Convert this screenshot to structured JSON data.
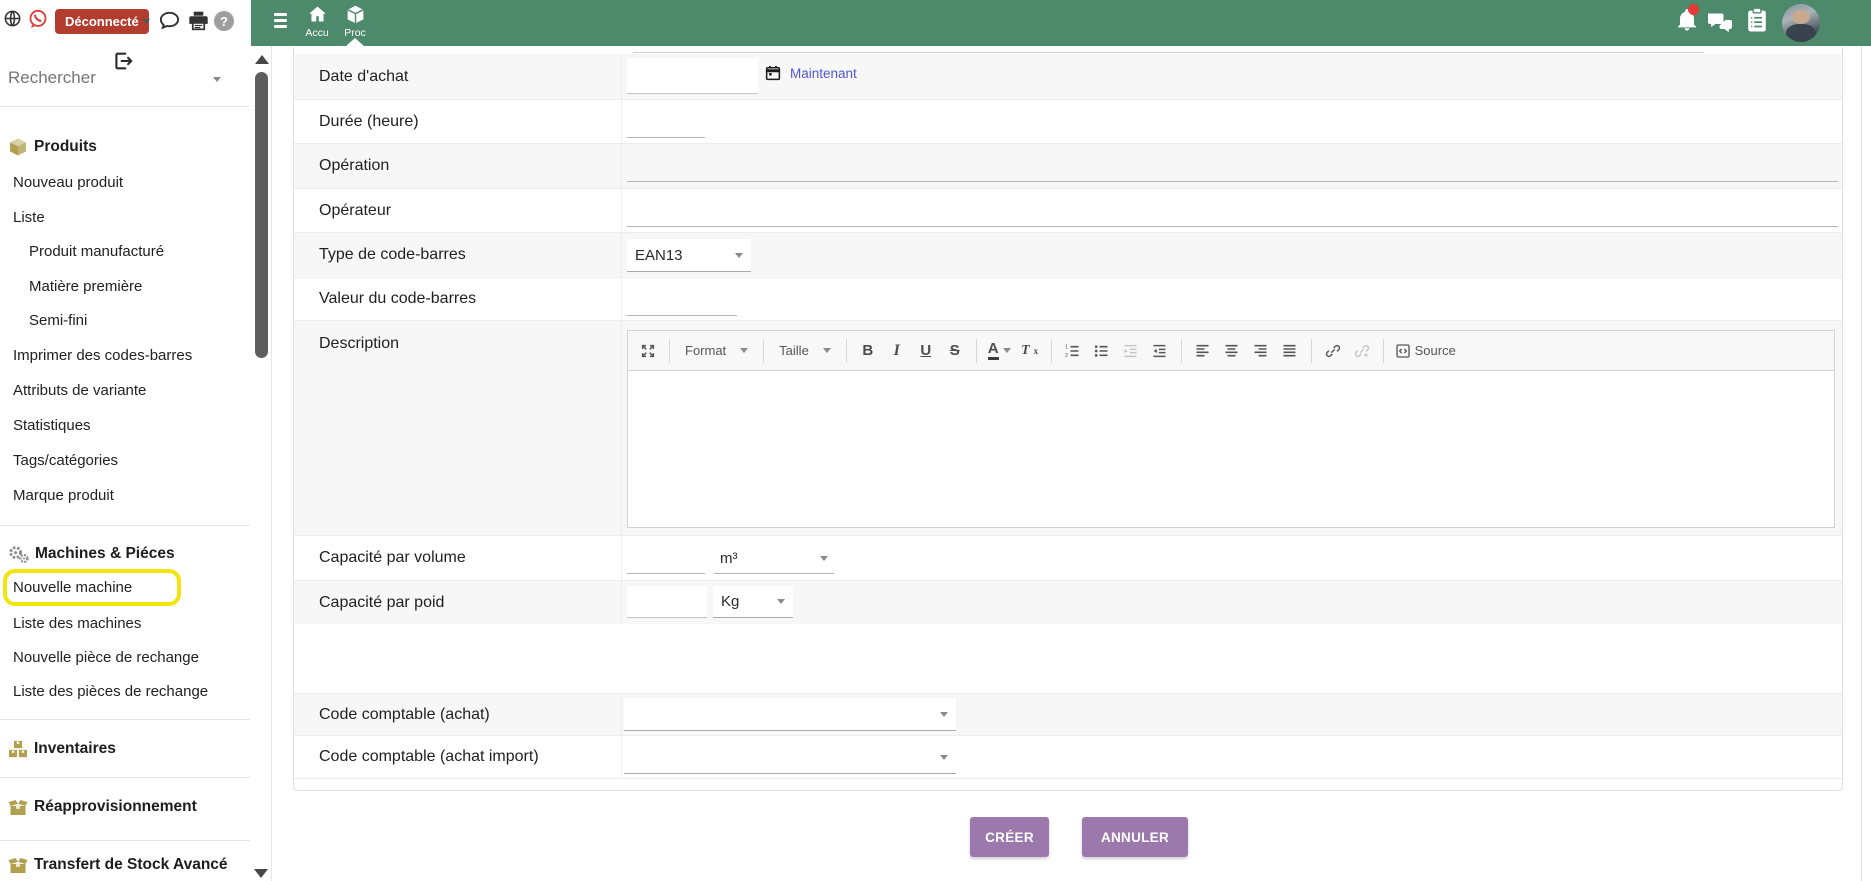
{
  "colors": {
    "topbar_green": "#4d8a6c",
    "button_purple": "#9c79ad",
    "badge_red": "#b23d2e",
    "highlight_yellow": "#f2e40c",
    "link_purple": "#5356d6",
    "gold_icon": "#b0a04f"
  },
  "header": {
    "status_badge": "Déconnecté",
    "nav_items": [
      {
        "label": "Accu"
      },
      {
        "label": "Proc"
      }
    ]
  },
  "sidebar": {
    "search_placeholder": "Rechercher",
    "produits_title": "Produits",
    "items_produits": [
      "Nouveau produit",
      "Liste",
      "Produit manufacturé",
      "Matière première",
      "Semi-fini",
      "Imprimer des codes-barres",
      "Attributs de variante",
      "Statistiques",
      "Tags/catégories",
      "Marque produit"
    ],
    "machines_title": "Machines & Piéces",
    "items_machines": [
      "Nouvelle machine",
      "Liste des machines",
      "Nouvelle pièce de rechange",
      "Liste des pièces de rechange"
    ],
    "inventaires_title": "Inventaires",
    "reappro_title": "Réapprovisionnement",
    "transfert_title": "Transfert de Stock Avancé"
  },
  "form": {
    "rows": [
      {
        "label": "Date d'achat",
        "now_link": "Maintenant",
        "value": ""
      },
      {
        "label": "Durée (heure)",
        "value": ""
      },
      {
        "label": "Opération",
        "value": ""
      },
      {
        "label": "Opérateur",
        "value": ""
      },
      {
        "label": "Type de code-barres",
        "value": "EAN13"
      },
      {
        "label": "Valeur du code-barres",
        "value": ""
      },
      {
        "label": "Description",
        "value": ""
      },
      {
        "label": "Capacité par volume",
        "value": "",
        "unit": "m³"
      },
      {
        "label": "Capacité par poid",
        "value": "",
        "unit": "Kg"
      }
    ],
    "rows2": [
      {
        "label": "Code comptable (achat)",
        "value": ""
      },
      {
        "label": "Code comptable (achat import)",
        "value": ""
      }
    ]
  },
  "editor": {
    "format_label": "Format",
    "size_label": "Taille",
    "source_label": "Source",
    "icon_buttons": [
      "maximize",
      "bold",
      "italic",
      "underline",
      "strikethrough",
      "text-color",
      "remove-format",
      "numbered-list",
      "bulleted-list",
      "outdent",
      "indent",
      "align-left",
      "align-center",
      "align-right",
      "justify",
      "link",
      "unlink",
      "source"
    ]
  },
  "actions": {
    "create": "CRÉER",
    "cancel": "ANNULER"
  }
}
